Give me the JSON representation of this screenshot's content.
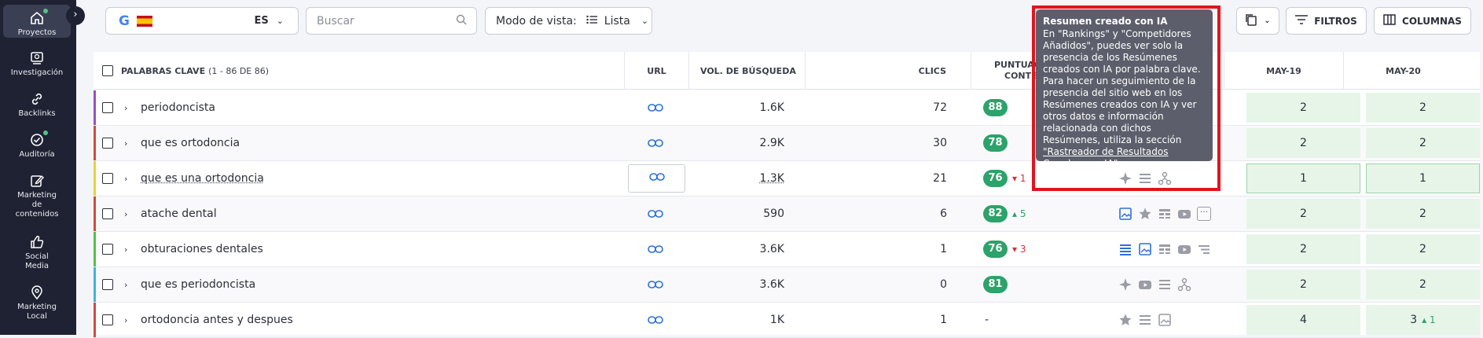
{
  "sidebar": {
    "items": [
      {
        "label": "Proyectos",
        "icon": "home-icon"
      },
      {
        "label": "Investigación",
        "icon": "research-icon"
      },
      {
        "label": "Backlinks",
        "icon": "link-icon"
      },
      {
        "label": "Auditoría",
        "icon": "audit-icon"
      },
      {
        "label": "Marketing de contenidos",
        "icon": "edit-icon"
      },
      {
        "label": "Social Media",
        "icon": "thumbs-up-icon"
      },
      {
        "label": "Marketing Local",
        "icon": "location-pin-icon"
      }
    ]
  },
  "toolbar": {
    "country_code": "ES",
    "search_placeholder": "Buscar",
    "view_mode_label": "Modo de vista:",
    "view_mode_value": "Lista",
    "filters_label": "FILTROS",
    "columns_label": "COLUMNAS"
  },
  "table": {
    "headers": {
      "keywords": "PALABRAS CLAVE",
      "keywords_count": "(1 - 86 DE 86)",
      "url": "URL",
      "volume": "VOL. DE BÚSQUEDA",
      "clicks": "CLICS",
      "content_score_line1": "PUNTUACI",
      "content_score_line2": "CONTE",
      "date1": "MAY-19",
      "date2": "MAY-20"
    },
    "rows": [
      {
        "keyword": "periodoncista",
        "volume": "1.6K",
        "clicks": "72",
        "score": "88",
        "delta": "",
        "pos1": "2",
        "pos2": "2"
      },
      {
        "keyword": "que es ortodoncia",
        "volume": "2.9K",
        "clicks": "30",
        "score": "78",
        "delta": "",
        "pos1": "2",
        "pos2": "2"
      },
      {
        "keyword": "que es una ortodoncia",
        "volume": "1.3K",
        "clicks": "21",
        "score": "76",
        "delta": "▾ 1",
        "pos1": "1",
        "pos2": "1"
      },
      {
        "keyword": "atache dental",
        "volume": "590",
        "clicks": "6",
        "score": "82",
        "delta": "▴ 5",
        "pos1": "2",
        "pos2": "2"
      },
      {
        "keyword": "obturaciones dentales",
        "volume": "3.6K",
        "clicks": "1",
        "score": "76",
        "delta": "▾ 3",
        "pos1": "2",
        "pos2": "2"
      },
      {
        "keyword": "que es periodoncista",
        "volume": "3.6K",
        "clicks": "0",
        "score": "81",
        "delta": "",
        "pos1": "2",
        "pos2": "2"
      },
      {
        "keyword": "ortodoncia antes y despues",
        "volume": "1K",
        "clicks": "1",
        "score": "-",
        "delta": "",
        "pos1": "4",
        "pos2": "3",
        "pos2_delta": "▴ 1"
      }
    ]
  },
  "tooltip": {
    "title": "Resumen creado con IA",
    "body": "En \"Rankings\" y \"Competidores Añadidos\", puedes ver solo la presencia de los Resúmenes creados con IA por palabra clave. Para hacer un seguimiento de la presencia del sitio web en los Resúmenes creados con IA y ver otros datos e información relacionada con dichos Resúmenes, utiliza la sección ",
    "link": "\"Rastreador de Resultados Creados con IA\"",
    "end": "."
  },
  "colors": {
    "sidebar_bg": "#1f2232",
    "score_green": "#2da26a",
    "delta_up": "#2da26a",
    "delta_down": "#d6303a",
    "link_blue": "#2a6fdb",
    "position_bg": "#e6f5e8",
    "highlight_red": "#e0141e",
    "tooltip_bg": "#5c5f6b"
  }
}
